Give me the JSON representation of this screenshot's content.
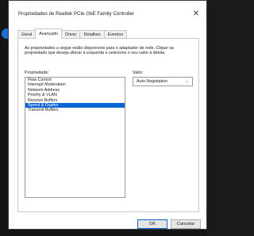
{
  "window": {
    "title": "Propriedades de Realtek PCIe GbE Family Controller",
    "close_glyph": "✕"
  },
  "tabs": [
    {
      "label": "Geral",
      "active": false
    },
    {
      "label": "Avançado",
      "active": true
    },
    {
      "label": "Driver",
      "active": false
    },
    {
      "label": "Detalhes",
      "active": false
    },
    {
      "label": "Eventos",
      "active": false
    }
  ],
  "panel": {
    "description": "As propriedades a seguir estão disponíveis para o adaptador de rede. Clique na propriedade que deseja alterar à esquerda e selecione o seu valor à direita.",
    "property_label": "Propriedade:",
    "value_label": "Valor:",
    "properties": [
      {
        "label": "Flow Control",
        "selected": false
      },
      {
        "label": "Interrupt Moderation",
        "selected": false
      },
      {
        "label": "Network Address",
        "selected": false
      },
      {
        "label": "Priority & VLAN",
        "selected": false
      },
      {
        "label": "Receive Buffers",
        "selected": false
      },
      {
        "label": "Speed & Duplex",
        "selected": true
      },
      {
        "label": "Transmit Buffers",
        "selected": false
      }
    ],
    "selected_value": "Auto Negotiation"
  },
  "buttons": {
    "ok": "OK",
    "cancel": "Cancelar"
  },
  "colors": {
    "accent": "#0a64d6",
    "backdrop": "#151515"
  }
}
